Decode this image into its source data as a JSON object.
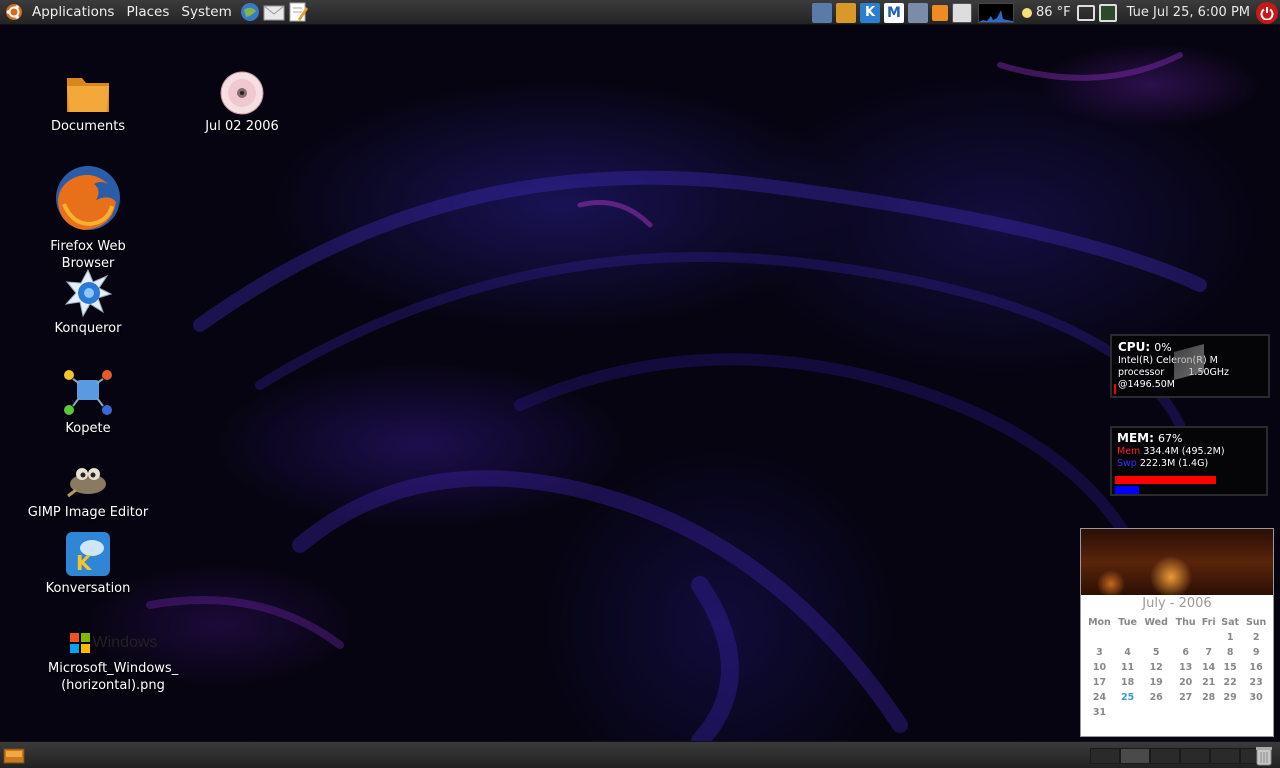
{
  "top_panel": {
    "menus": [
      "Applications",
      "Places",
      "System"
    ],
    "launchers": [
      "web-browser-icon",
      "mail-icon",
      "text-editor-icon"
    ],
    "tray_icons": [
      "network-icon",
      "file-manager-icon",
      "konqueror-tray-icon",
      "gmail-icon",
      "puzzle-icon",
      "update-icon",
      "battery-icon"
    ],
    "weather": "86 °F",
    "clock": "Tue Jul 25,  6:00 PM"
  },
  "desktop_icons": [
    {
      "name": "documents-folder",
      "label": "Documents"
    },
    {
      "name": "cd-disc",
      "label": "Jul 02 2006"
    },
    {
      "name": "firefox",
      "label": "Firefox Web Browser"
    },
    {
      "name": "konqueror",
      "label": "Konqueror"
    },
    {
      "name": "kopete",
      "label": "Kopete"
    },
    {
      "name": "gimp",
      "label": "GIMP Image Editor"
    },
    {
      "name": "konversation",
      "label": "Konversation"
    },
    {
      "name": "windows-png",
      "label": "Microsoft_Windows_\n(horizontal).png",
      "label_line1": "Microsoft_Windows_",
      "label_line2": "(horizontal).png",
      "logo_text": "Windows"
    }
  ],
  "cpu_widget": {
    "title": "CPU:",
    "value": "0%",
    "line1": "Intel(R) Celeron(R) M",
    "line2": "processor        1.50GHz",
    "line3": "@1496.50M"
  },
  "mem_widget": {
    "title": "MEM:",
    "value": "67%",
    "mem_label": "Mem",
    "mem_value": "334.4M (495.2M)",
    "swp_label": "Swp",
    "swp_value": "222.3M (1.4G)",
    "mem_fraction": 0.67,
    "swp_fraction": 0.16,
    "mem_color": "#ff0000",
    "swp_color": "#0000ff"
  },
  "calendar": {
    "month_title": "July - 2006",
    "weekdays": [
      "Mon",
      "Tue",
      "Wed",
      "Thu",
      "Fri",
      "Sat",
      "Sun"
    ],
    "weeks": [
      [
        "",
        "",
        "",
        "",
        "",
        "1",
        "2"
      ],
      [
        "3",
        "4",
        "5",
        "6",
        "7",
        "8",
        "9"
      ],
      [
        "10",
        "11",
        "12",
        "13",
        "14",
        "15",
        "16"
      ],
      [
        "17",
        "18",
        "19",
        "20",
        "21",
        "22",
        "23"
      ],
      [
        "24",
        "25",
        "26",
        "27",
        "28",
        "29",
        "30"
      ],
      [
        "31",
        "",
        "",
        "",
        "",
        "",
        ""
      ]
    ],
    "today": "25"
  },
  "bottom_panel": {
    "left_icon": "show-desktop-icon",
    "workspaces": 6,
    "active_workspace": 2,
    "right_icon": "trash-icon"
  }
}
